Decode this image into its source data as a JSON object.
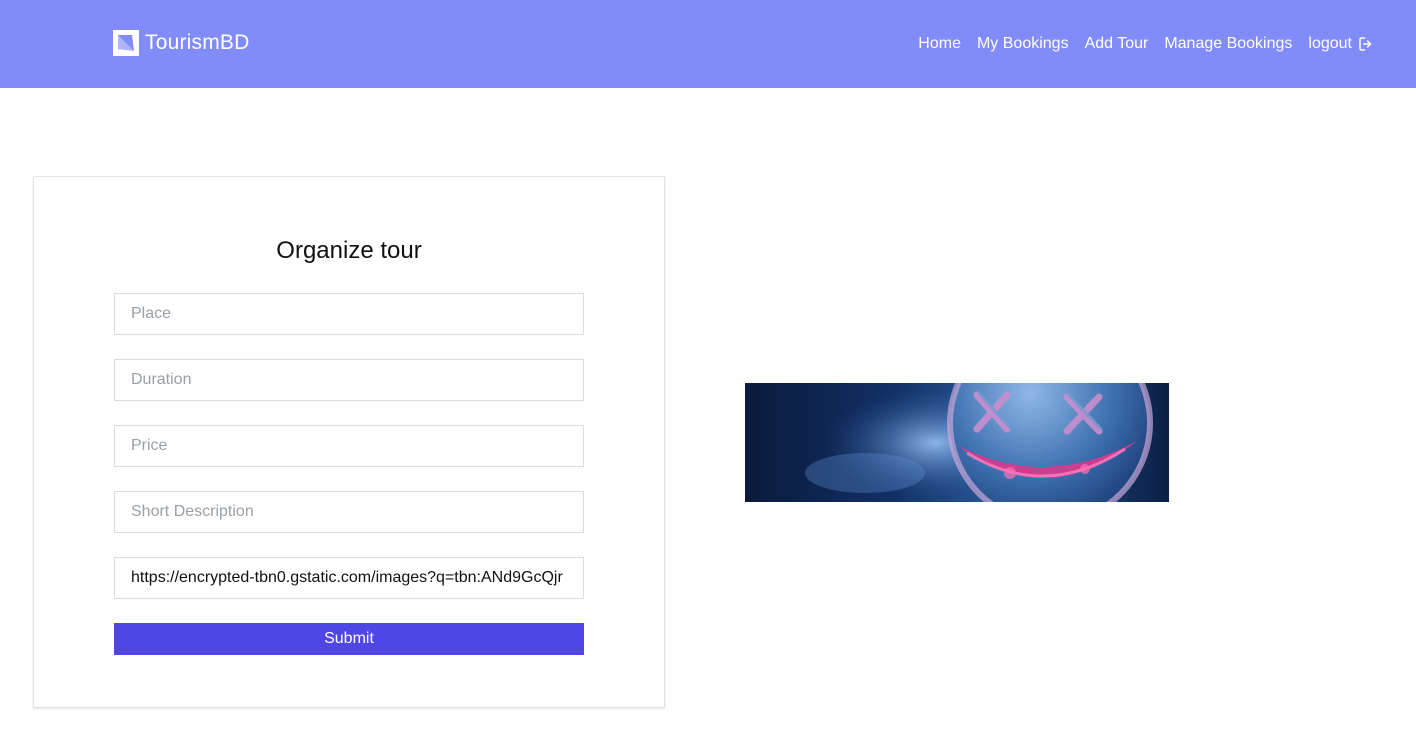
{
  "brand": {
    "name": "TourismBD",
    "logo_icon": "brand-square-logo-icon"
  },
  "nav": {
    "items": [
      {
        "label": "Home"
      },
      {
        "label": "My Bookings"
      },
      {
        "label": "Add Tour"
      },
      {
        "label": "Manage Bookings"
      },
      {
        "label": "logout",
        "icon": "logout-icon"
      }
    ]
  },
  "form": {
    "title": "Organize tour",
    "fields": [
      {
        "placeholder": "Place",
        "value": ""
      },
      {
        "placeholder": "Duration",
        "value": ""
      },
      {
        "placeholder": "Price",
        "value": ""
      },
      {
        "placeholder": "Short Description",
        "value": ""
      },
      {
        "placeholder": "",
        "value": "https://encrypted-tbn0.gstatic.com/images?q=tbn:ANd9GcQjr"
      }
    ],
    "submit_label": "Submit"
  },
  "colors": {
    "navbar": "#818cf8",
    "accent": "#4f46e5"
  }
}
